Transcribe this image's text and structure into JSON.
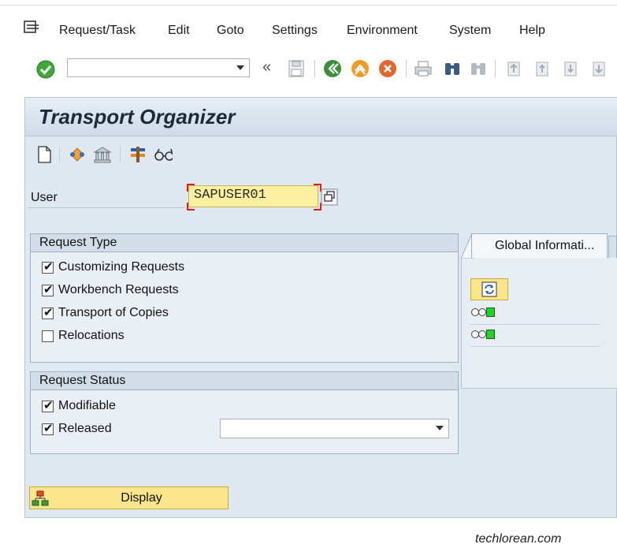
{
  "menu": {
    "items": [
      "Request/Task",
      "Edit",
      "Goto",
      "Settings",
      "Environment",
      "System",
      "Help"
    ]
  },
  "toolbar": {
    "command_field_value": "",
    "icons": [
      "enter-check-icon",
      "back-icon",
      "save-icon",
      "back-green-icon",
      "exit-icon",
      "cancel-icon",
      "print-icon",
      "find-icon",
      "find-next-icon",
      "first-page-icon",
      "previous-page-icon",
      "next-page-icon",
      "last-page-icon"
    ]
  },
  "page": {
    "title": "Transport Organizer"
  },
  "app_toolbar": {
    "icons": [
      "create-document-icon",
      "transport-tree-icon",
      "building-icon",
      "tools-icon",
      "glasses-icon"
    ]
  },
  "user": {
    "label": "User",
    "value": "SAPUSER01"
  },
  "request_type": {
    "title": "Request Type",
    "options": [
      {
        "label": "Customizing Requests",
        "checked": true
      },
      {
        "label": "Workbench Requests",
        "checked": true
      },
      {
        "label": "Transport of Copies",
        "checked": true
      },
      {
        "label": "Relocations",
        "checked": false
      }
    ]
  },
  "request_status": {
    "title": "Request Status",
    "options": [
      {
        "label": "Modifiable",
        "checked": true
      },
      {
        "label": "Released",
        "checked": true
      }
    ],
    "released_select_value": ""
  },
  "global_info": {
    "tab_label": "Global Informati..."
  },
  "display_button": {
    "label": "Display"
  },
  "watermark": "techlorean.com",
  "colors": {
    "accent_yellow": "#fde58c",
    "panel_bg": "#dfe8f0",
    "status_green": "#22d12a",
    "required_marker": "#e21b1b"
  }
}
